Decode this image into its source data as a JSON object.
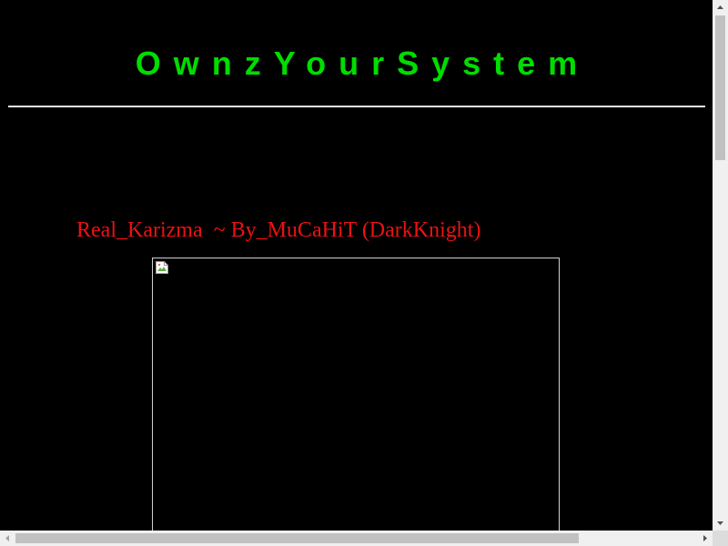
{
  "page": {
    "title": "OwnzYourSystem",
    "credit": "Real_Karizma  ~ By_MuCaHiT (DarkKnight)"
  },
  "colors": {
    "background": "#000000",
    "title": "#00dd00",
    "credit": "#ee1111",
    "rule": "#e6e6e6"
  },
  "image": {
    "icon": "broken-image-icon"
  },
  "scrollbars": {
    "vertical_icons": [
      "scroll-up-arrow-icon",
      "scroll-down-arrow-icon"
    ],
    "horizontal_icons": [
      "scroll-left-arrow-icon",
      "scroll-right-arrow-icon"
    ]
  }
}
